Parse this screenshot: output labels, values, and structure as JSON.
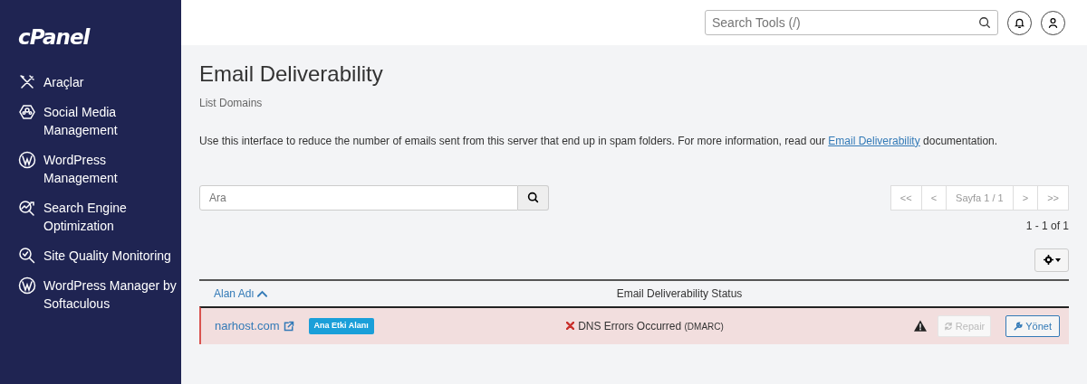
{
  "sidebar": {
    "logo": "cPanel",
    "items": [
      {
        "kind": "tools",
        "label": "Araçlar"
      },
      {
        "kind": "social",
        "label": "Social Media Management"
      },
      {
        "kind": "wordpress",
        "label": "WordPress Management"
      },
      {
        "kind": "seo",
        "label": "Search Engine Optimization"
      },
      {
        "kind": "quality",
        "label": "Site Quality Monitoring"
      },
      {
        "kind": "wordpress",
        "label": "WordPress Manager by Softaculous"
      }
    ]
  },
  "topbar": {
    "search": {
      "placeholder": "Search Tools (/)"
    }
  },
  "page": {
    "title": "Email Deliverability",
    "subtitle": "List Domains",
    "intro": {
      "before": "Use this interface to reduce the number of emails sent from this server that end up in spam folders. For more information, read our",
      "link": "Email Deliverability",
      "after": "documentation."
    }
  },
  "filter": {
    "placeholder": "Ara"
  },
  "pager": {
    "buttons": [
      {
        "label": "<<",
        "disabled": true
      },
      {
        "label": "<",
        "disabled": true
      },
      {
        "label": "Sayfa 1 / 1",
        "disabled": true
      },
      {
        "label": ">",
        "disabled": true
      },
      {
        "label": ">>",
        "disabled": true
      }
    ],
    "count": "1 - 1 of 1"
  },
  "table": {
    "columns": [
      {
        "label": "Alan Adı",
        "sortable": true
      },
      {
        "label": "Email Deliverability Status",
        "sortable": false
      }
    ],
    "rows": [
      {
        "domain": "narhost.com",
        "badge": "Ana Etki Alanı",
        "error": true,
        "status": "DNS Errors Occurred",
        "detail": "(DMARC)",
        "warning": true,
        "repair": {
          "label": "Repair",
          "disabled": true
        },
        "manage": {
          "label": "Yönet"
        }
      }
    ]
  }
}
